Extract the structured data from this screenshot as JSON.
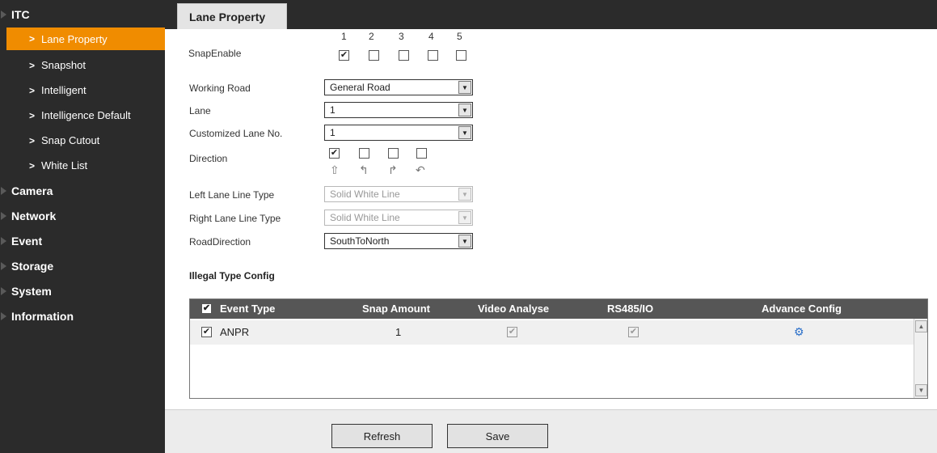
{
  "sidebar": {
    "itc": "ITC",
    "items": [
      {
        "label": "Lane Property",
        "active": true
      },
      {
        "label": "Snapshot"
      },
      {
        "label": "Intelligent"
      },
      {
        "label": "Intelligence Default"
      },
      {
        "label": "Snap Cutout"
      },
      {
        "label": "White List"
      }
    ],
    "sections": [
      "Camera",
      "Network",
      "Event",
      "Storage",
      "System",
      "Information"
    ]
  },
  "tab": {
    "title": "Lane Property"
  },
  "snap_enable": {
    "label": "SnapEnable",
    "numbers": [
      "1",
      "2",
      "3",
      "4",
      "5"
    ],
    "checked": [
      true,
      false,
      false,
      false,
      false
    ]
  },
  "form": {
    "working_road": {
      "label": "Working Road",
      "value": "General Road"
    },
    "lane": {
      "label": "Lane",
      "value": "1"
    },
    "customized_lane": {
      "label": "Customized Lane No.",
      "value": "1"
    },
    "direction": {
      "label": "Direction",
      "checked": [
        true,
        false,
        false,
        false
      ],
      "icons": [
        "straight-arrow-icon",
        "left-turn-arrow-icon",
        "right-turn-arrow-icon",
        "u-turn-arrow-icon"
      ]
    },
    "left_lane": {
      "label": "Left Lane Line Type",
      "value": "Solid White Line"
    },
    "right_lane": {
      "label": "Right Lane Line Type",
      "value": "Solid White Line"
    },
    "road_direction": {
      "label": "RoadDirection",
      "value": "SouthToNorth"
    }
  },
  "illegal": {
    "title": "Illegal Type Config",
    "headers": {
      "event_type": "Event Type",
      "snap_amount": "Snap Amount",
      "video_analyse": "Video Analyse",
      "rs485": "RS485/IO",
      "advance": "Advance Config"
    },
    "rows": [
      {
        "event": "ANPR",
        "snap_amount": "1",
        "checked": true,
        "video_analyse": true,
        "rs485": true
      }
    ]
  },
  "buttons": {
    "refresh": "Refresh",
    "save": "Save"
  },
  "colors": {
    "accent": "#f08c00",
    "sidebar_bg": "#2b2b2b",
    "header_bg": "#565656"
  }
}
